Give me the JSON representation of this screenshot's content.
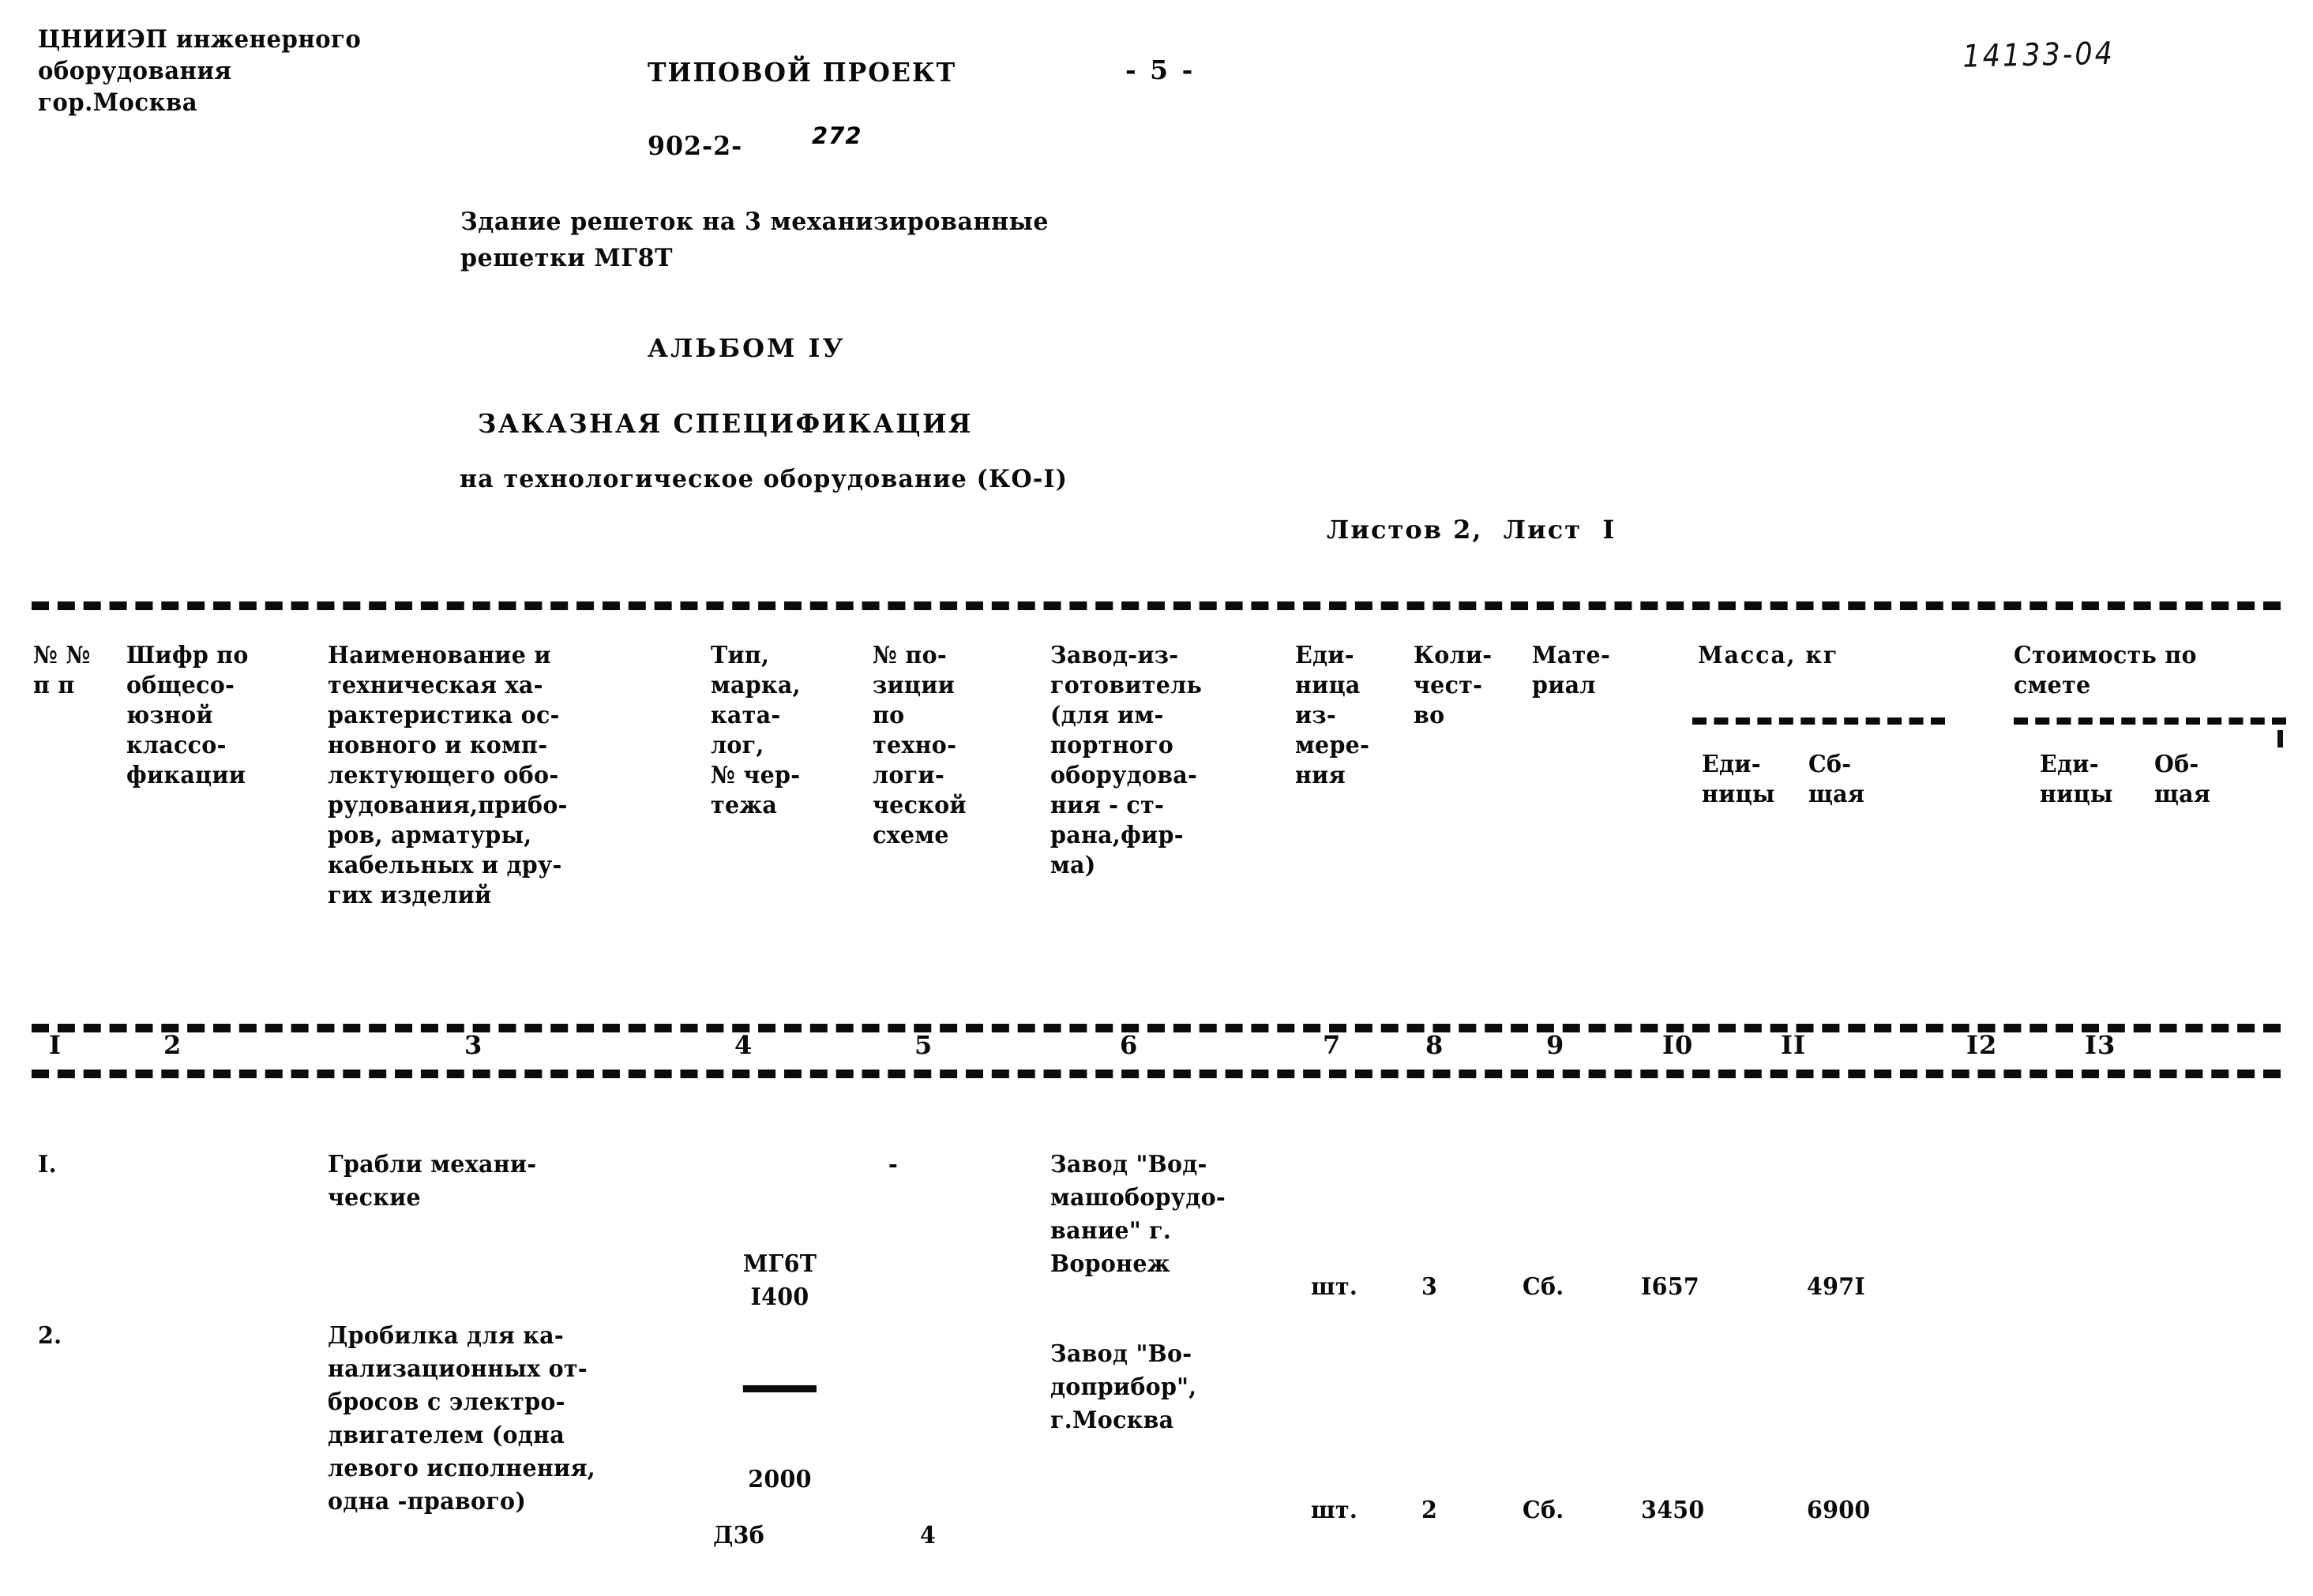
{
  "header": {
    "organization": "ЦНИИЭП инженерного\nоборудования\nгор.Москва",
    "project_label": "ТИПОВОЙ ПРОЕКТ",
    "project_code": "902-2-",
    "project_code_suffix": "272",
    "page_number": "- 5 -",
    "handwritten_code": "14133-04",
    "building_title": "Здание решеток на 3 механизированные\nрешетки МГ8Т",
    "album": "АЛЬБОМ IУ",
    "spec_title": "ЗАКАЗНАЯ СПЕЦИФИКАЦИЯ",
    "spec_subtitle": "на технологическое оборудование (КО-I)",
    "sheets": "Листов 2,  Лист  I"
  },
  "table": {
    "headers": {
      "col1": "№ №\nп п",
      "col2": "Шифр по\nобщесо-\nюзной\nклассо-\nфикации",
      "col3": "Наименование и\nтехническая ха-\nрактеристика ос-\nновного и комп-\nлектующего обо-\nрудования,прибо-\nров, арматуры,\nкабельных и дру-\nгих изделий",
      "col4": "Тип,\nмарка,\nката-\nлог,\n№ чер-\nтежа",
      "col5": "№ по-\nзиции\nпо\nтехно-\nлоги-\nческой\nсхеме",
      "col6": "Завод-из-\nготовитель\n(для им-\nпортного\nоборудова-\nния - ст-\nрана,фир-\nма)",
      "col7": "Еди-\nница\nиз-\nмере-\nния",
      "col8": "Коли-\nчест-\nво",
      "col9": "Мате-\nриал",
      "col10_group": "Масса, кг",
      "col10": "Еди-\nницы",
      "col11": "Сб-\nщая",
      "col12_group": "Стоимость по\nсмете",
      "col12": "Еди-\nницы",
      "col13": "Об-\nщая"
    },
    "column_numbers": [
      "I",
      "2",
      "3",
      "4",
      "5",
      "6",
      "7",
      "8",
      "9",
      "I0",
      "II",
      "I2",
      "I3"
    ],
    "rows": [
      {
        "no": "I.",
        "code": "",
        "name": "Грабли механи-\nческие",
        "type_numerator": "МГ6Т\nI400",
        "type_denominator": "2000",
        "position": "-",
        "manufacturer": "Завод \"Вод-\nмашоборудо-\nвание\" г.\nВоронеж",
        "unit": "шт.",
        "quantity": "3",
        "material": "Сб.",
        "mass_unit": "I657",
        "mass_total": "497I",
        "cost_unit": "",
        "cost_total": ""
      },
      {
        "no": "2.",
        "code": "",
        "name": "Дробилка для ка-\nнализационных от-\nбросов с электро-\nдвигателем (одна\nлевого исполнения,\nодна -правого)",
        "type": "Д3б",
        "position": "4",
        "manufacturer": "Завод \"Во-\nдоприбор\",\nг.Москва",
        "unit": "шт.",
        "quantity": "2",
        "material": "Сб.",
        "mass_unit": "3450",
        "mass_total": "6900",
        "cost_unit": "",
        "cost_total": ""
      }
    ]
  }
}
